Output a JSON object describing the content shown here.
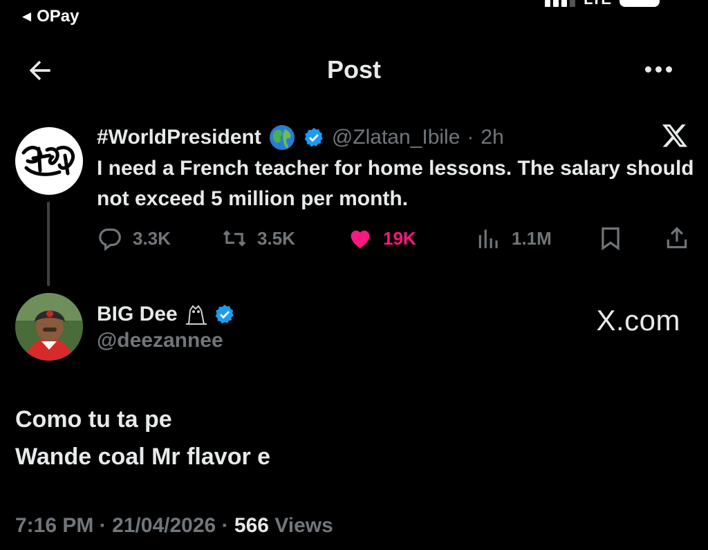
{
  "status_bar": {
    "back_app": "OPay",
    "network": "LTE"
  },
  "header": {
    "title": "Post",
    "back_icon": "arrow-left-icon",
    "more_icon": "more-horizontal-icon"
  },
  "quoted_post": {
    "display_name": "#WorldPresident",
    "emoji_icon": "globe-icon",
    "verified_icon": "verified-badge-icon",
    "handle": "@Zlatan_Ibile",
    "separator": "·",
    "time": "2h",
    "text": "I need a French teacher for home lessons. The salary should not exceed 5 million per month.",
    "actions": {
      "replies": "3.3K",
      "reposts": "3.5K",
      "likes": "19K",
      "views": "1.1M"
    },
    "like_color": "#f91880"
  },
  "main_post": {
    "display_name": "BIG Dee",
    "handle": "@deezannee",
    "watermark": "X.com",
    "text_lines": [
      "Como tu ta pe",
      "Wande coal Mr flavor e"
    ],
    "meta": {
      "time": "7:16 PM",
      "sep": " · ",
      "date": "21/04/2026",
      "sep2": " · ",
      "views_count": "566",
      "views_label": " Views"
    }
  },
  "colors": {
    "background": "#000000",
    "text": "#e7e9ea",
    "muted": "#71767b",
    "verified": "#1d9bf0"
  }
}
